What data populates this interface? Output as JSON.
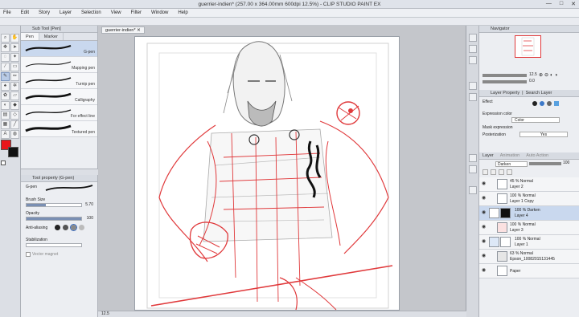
{
  "app": {
    "title": "guerrier-indien* (257.00 x 364.00mm 600dpi 12.5%) - CLIP STUDIO PAINT EX",
    "window_buttons": [
      "—",
      "□",
      "✕"
    ]
  },
  "menu": [
    "File",
    "Edit",
    "Story",
    "Layer",
    "Selection",
    "View",
    "Filter",
    "Window",
    "Help"
  ],
  "subtool": {
    "header": "Sub Tool [Pen]",
    "tabs": [
      "Pen",
      "Marker"
    ],
    "brushes": [
      {
        "label": "G-pen",
        "selected": true
      },
      {
        "label": "Mapping pen",
        "selected": false
      },
      {
        "label": "Turnip pen",
        "selected": false
      },
      {
        "label": "Calligraphy",
        "selected": false
      },
      {
        "label": "For effect line",
        "selected": false
      },
      {
        "label": "Textured pen",
        "selected": false
      }
    ]
  },
  "toolprop": {
    "header": "Tool property (G-pen)",
    "name": "G-pen",
    "brush_size_label": "Brush Size",
    "brush_size_value": "5.70",
    "brush_size_fraction": 0.35,
    "opacity_label": "Opacity",
    "opacity_value": "100",
    "opacity_fraction": 1.0,
    "antialias_label": "Anti-aliasing",
    "stabilization_label": "Stabilization",
    "stabilization_value": "",
    "vector_magnet_label": "Vector magnet"
  },
  "canvas": {
    "doc_tab": "guerrier-indien*",
    "zoom": "12.5"
  },
  "navigator": {
    "header": "Navigator",
    "zoom_value": "12.5",
    "rotation_value": "0.0"
  },
  "layer_property": {
    "header": "Layer Property",
    "tab2": "Search Layer",
    "effect_label": "Effect",
    "expression_color_label": "Expression color",
    "expression_color_value": "Color",
    "mask_expression_label": "Mask expression",
    "posterization_label": "Posterization",
    "posterization_value": "Yes"
  },
  "layers": {
    "header": "Layer",
    "tabs": [
      "Layer",
      "Animation",
      "Auto Action"
    ],
    "blend_mode": "Darken",
    "opacity": "100",
    "items": [
      {
        "line1": "45 %  Normal",
        "line2": "Layer 2",
        "selected": false
      },
      {
        "line1": "100 %  Normal",
        "line2": "Layer 1 Copy",
        "selected": false
      },
      {
        "line1": "100 %  Darken",
        "line2": "Layer 4",
        "selected": true
      },
      {
        "line1": "100 %  Normal",
        "line2": "Layer 3",
        "selected": false
      },
      {
        "line1": "100 %  Normal",
        "line2": "Layer 1",
        "selected": false
      },
      {
        "line1": "63 %  Normal",
        "line2": "Epson_10082015131445",
        "selected": false
      },
      {
        "line1": "",
        "line2": "Paper",
        "selected": false
      }
    ]
  },
  "colors": {
    "main": "#e8151b",
    "sub": "#111111",
    "accent_red": "#e0393b",
    "select_blue": "#c9d8ee"
  }
}
